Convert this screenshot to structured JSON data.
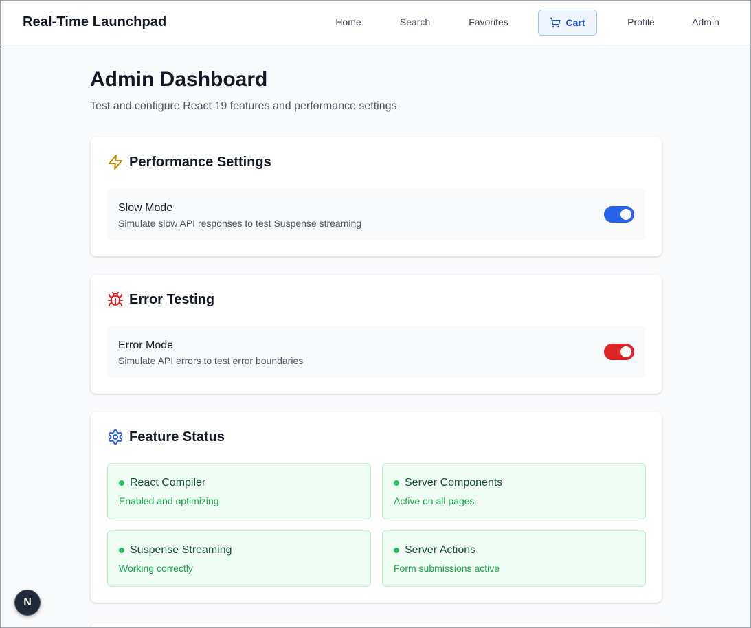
{
  "brand": "Real-Time Launchpad",
  "nav": {
    "home": "Home",
    "search": "Search",
    "favorites": "Favorites",
    "cart": "Cart",
    "profile": "Profile",
    "admin": "Admin"
  },
  "page": {
    "title": "Admin Dashboard",
    "subtitle": "Test and configure React 19 features and performance settings"
  },
  "performance": {
    "title": "Performance Settings",
    "icon": "lightning-icon",
    "setting_name": "Slow Mode",
    "setting_desc": "Simulate slow API responses to test Suspense streaming",
    "enabled": true,
    "toggle_color": "#2563eb"
  },
  "errors": {
    "title": "Error Testing",
    "icon": "bug-icon",
    "setting_name": "Error Mode",
    "setting_desc": "Simulate API errors to test error boundaries",
    "enabled": true,
    "toggle_color": "#dc2626"
  },
  "features": {
    "title": "Feature Status",
    "icon": "gear-icon",
    "items": [
      {
        "name": "React Compiler",
        "desc": "Enabled and optimizing"
      },
      {
        "name": "Server Components",
        "desc": "Active on all pages"
      },
      {
        "name": "Suspense Streaming",
        "desc": "Working correctly"
      },
      {
        "name": "Server Actions",
        "desc": "Form submissions active"
      }
    ]
  },
  "dev_badge": "N",
  "colors": {
    "accent": "#2563eb",
    "danger": "#dc2626",
    "success": "#22c55e",
    "warning_icon": "#ca8a04"
  }
}
